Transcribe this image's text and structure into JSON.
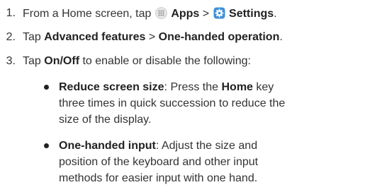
{
  "steps": [
    {
      "num": "1.",
      "pre": "From a Home screen, tap",
      "apps_icon": "apps-grid-icon",
      "apps": "Apps",
      "sep": ">",
      "settings_icon": "settings-gear-icon",
      "settings": "Settings",
      "post": "."
    },
    {
      "num": "2.",
      "pre": "Tap",
      "item1": "Advanced features",
      "sep": ">",
      "item2": "One-handed operation",
      "post": "."
    },
    {
      "num": "3.",
      "pre": "Tap",
      "item": "On/Off",
      "post": "to enable or disable the following:"
    }
  ],
  "bullets": [
    {
      "term": "Reduce screen size",
      "colon": ":",
      "desc_pre": "Press the",
      "key": "Home",
      "desc_line1_end": "key",
      "desc_line2": "three times in quick succession to reduce the",
      "desc_line3": "size of the display."
    },
    {
      "term": "One-handed input",
      "colon": ":",
      "desc_line1": "Adjust the size and",
      "desc_line2": "position of the keyboard and other input",
      "desc_line3": "methods for easier input with one hand."
    }
  ],
  "colors": {
    "settings_icon_bg": "#3e8fd8",
    "apps_icon_bg": "#e6e6e6",
    "text": "#333333"
  }
}
